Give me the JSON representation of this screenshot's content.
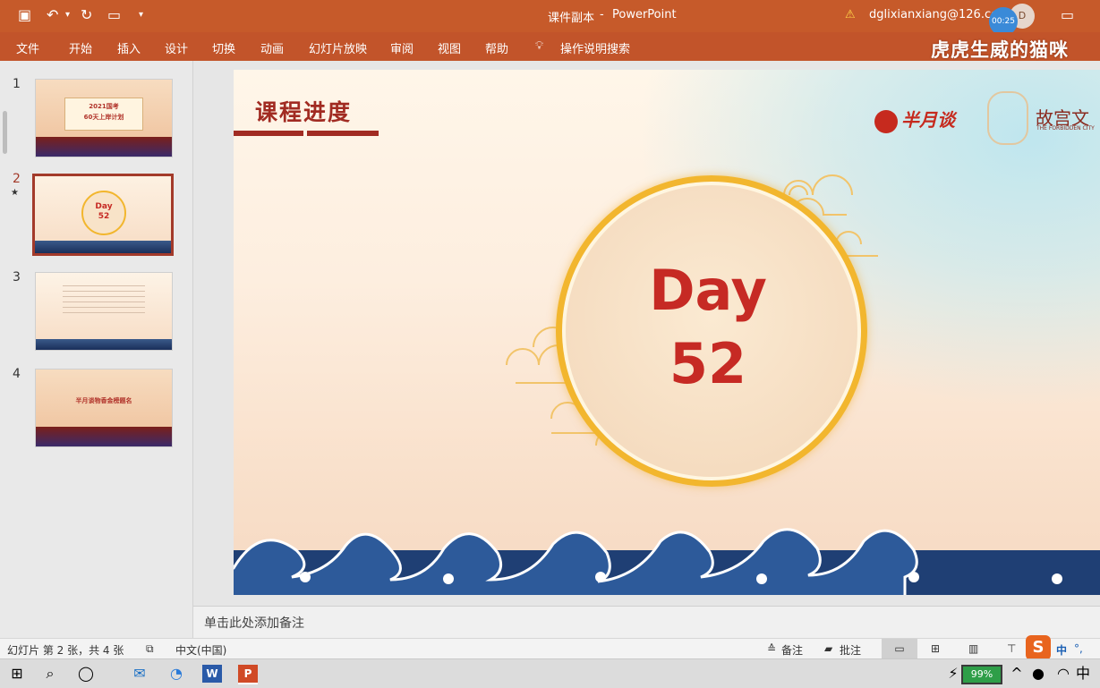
{
  "titlebar": {
    "doc_title": "课件副本",
    "separator": "-",
    "app_name": "PowerPoint",
    "warning": "⚠",
    "account": "dglixianxiang@126.co",
    "timer": "00:25",
    "avatar_letter": "D",
    "watermark": "虎虎生威的猫咪"
  },
  "ribbon": {
    "tabs": [
      "文件",
      "开始",
      "插入",
      "设计",
      "切换",
      "动画",
      "幻灯片放映",
      "审阅",
      "视图",
      "帮助"
    ],
    "search_label": "操作说明搜索"
  },
  "thumbnails": [
    {
      "num": "1",
      "line1": "2021国考",
      "line2": "60天上岸计划"
    },
    {
      "num": "2",
      "line1": "Day",
      "line2": "52"
    },
    {
      "num": "3"
    },
    {
      "num": "4",
      "line1": "半月谈物香金榜题名"
    }
  ],
  "slide": {
    "title": "课程进度",
    "logo_banyuetan": "半月谈",
    "logo_gugong": "故宫文",
    "logo_gugong_sub": "THE FORBIDDEN CITY",
    "day_label": "Day",
    "day_number": "52"
  },
  "notes": {
    "placeholder": "单击此处添加备注"
  },
  "statusbar": {
    "slide_info": "幻灯片 第 2 张，共 4 张",
    "language": "中文(中国)",
    "notes_btn": "备注",
    "comments_btn": "批注"
  },
  "taskbar": {
    "battery": "99%",
    "ime": "中"
  },
  "colors": {
    "accent": "#c2542a",
    "title_red": "#a12b22",
    "day_red": "#c62a24",
    "ring_gold": "#f2b62e"
  }
}
